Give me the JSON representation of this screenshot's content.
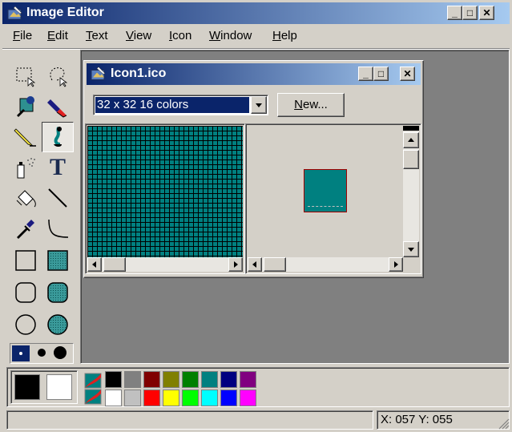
{
  "window": {
    "title": "Image Editor",
    "min": "_",
    "max": "□",
    "close": "✕"
  },
  "menu": [
    {
      "pre": "",
      "ul": "F",
      "post": "ile"
    },
    {
      "pre": "",
      "ul": "E",
      "post": "dit"
    },
    {
      "pre": "",
      "ul": "T",
      "post": "ext"
    },
    {
      "pre": "",
      "ul": "V",
      "post": "iew"
    },
    {
      "pre": "",
      "ul": "I",
      "post": "con"
    },
    {
      "pre": "",
      "ul": "W",
      "post": "indow"
    },
    {
      "pre": "",
      "ul": "H",
      "post": "elp"
    }
  ],
  "child": {
    "title": "Icon1.ico",
    "format_value": "32 x 32  16 colors",
    "new_button": {
      "ul": "N",
      "post": "ew..."
    },
    "min": "_",
    "max": "□",
    "close": "✕"
  },
  "tools": [
    {
      "name": "rect-select-tool-icon"
    },
    {
      "name": "lasso-select-tool-icon"
    },
    {
      "name": "color-picker-tool-icon"
    },
    {
      "name": "eraser-tool-icon"
    },
    {
      "name": "pencil-tool-icon"
    },
    {
      "name": "brush-tool-icon"
    },
    {
      "name": "airbrush-tool-icon"
    },
    {
      "name": "text-tool-icon",
      "glyph": "T"
    },
    {
      "name": "fill-bucket-tool-icon"
    },
    {
      "name": "line-tool-icon"
    },
    {
      "name": "eyedropper-tool-icon"
    },
    {
      "name": "curve-tool-icon"
    },
    {
      "name": "rectangle-tool-icon"
    },
    {
      "name": "filled-rectangle-tool-icon"
    },
    {
      "name": "rounded-rect-tool-icon"
    },
    {
      "name": "filled-rounded-rect-tool-icon"
    },
    {
      "name": "ellipse-tool-icon"
    },
    {
      "name": "filled-ellipse-tool-icon"
    }
  ],
  "colors": {
    "foreground": "#000000",
    "background": "#ffffff",
    "top_row": [
      "#000000",
      "#808080",
      "#800000",
      "#808000",
      "#008000",
      "#008080",
      "#000080",
      "#800080"
    ],
    "bottom_row": [
      "#ffffff",
      "#c0c0c0",
      "#ff0000",
      "#ffff00",
      "#00ff00",
      "#00ffff",
      "#0000ff",
      "#ff00ff"
    ],
    "icon_color": "#008080"
  },
  "status": {
    "coords": "X: 057  Y: 055"
  }
}
